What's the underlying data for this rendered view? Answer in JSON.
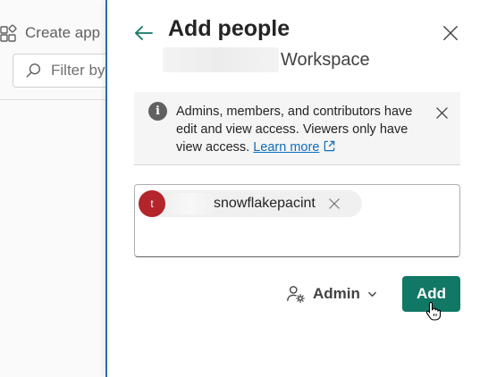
{
  "background": {
    "create_app_label": "Create app",
    "filter_placeholder": "Filter by"
  },
  "panel": {
    "title": "Add people",
    "workspace_suffix": "Workspace",
    "info": {
      "message": "Admins, members, and contributors have edit and view access. Viewers only have view access.",
      "learn_more": "Learn more"
    },
    "selected_people": [
      {
        "avatar_initial": "t",
        "name": "snowflakepacint"
      }
    ],
    "role": {
      "label": "Admin"
    },
    "add_button": "Add"
  },
  "colors": {
    "accent": "#117865",
    "panel_border": "#2c6cb6",
    "avatar": "#b3252b",
    "link": "#0f6cbd"
  },
  "icons": [
    "grid-apps-icon",
    "search-icon",
    "back-arrow-icon",
    "close-icon",
    "info-icon",
    "external-link-icon",
    "person-settings-icon",
    "chevron-down-icon",
    "hand-cursor-icon"
  ]
}
